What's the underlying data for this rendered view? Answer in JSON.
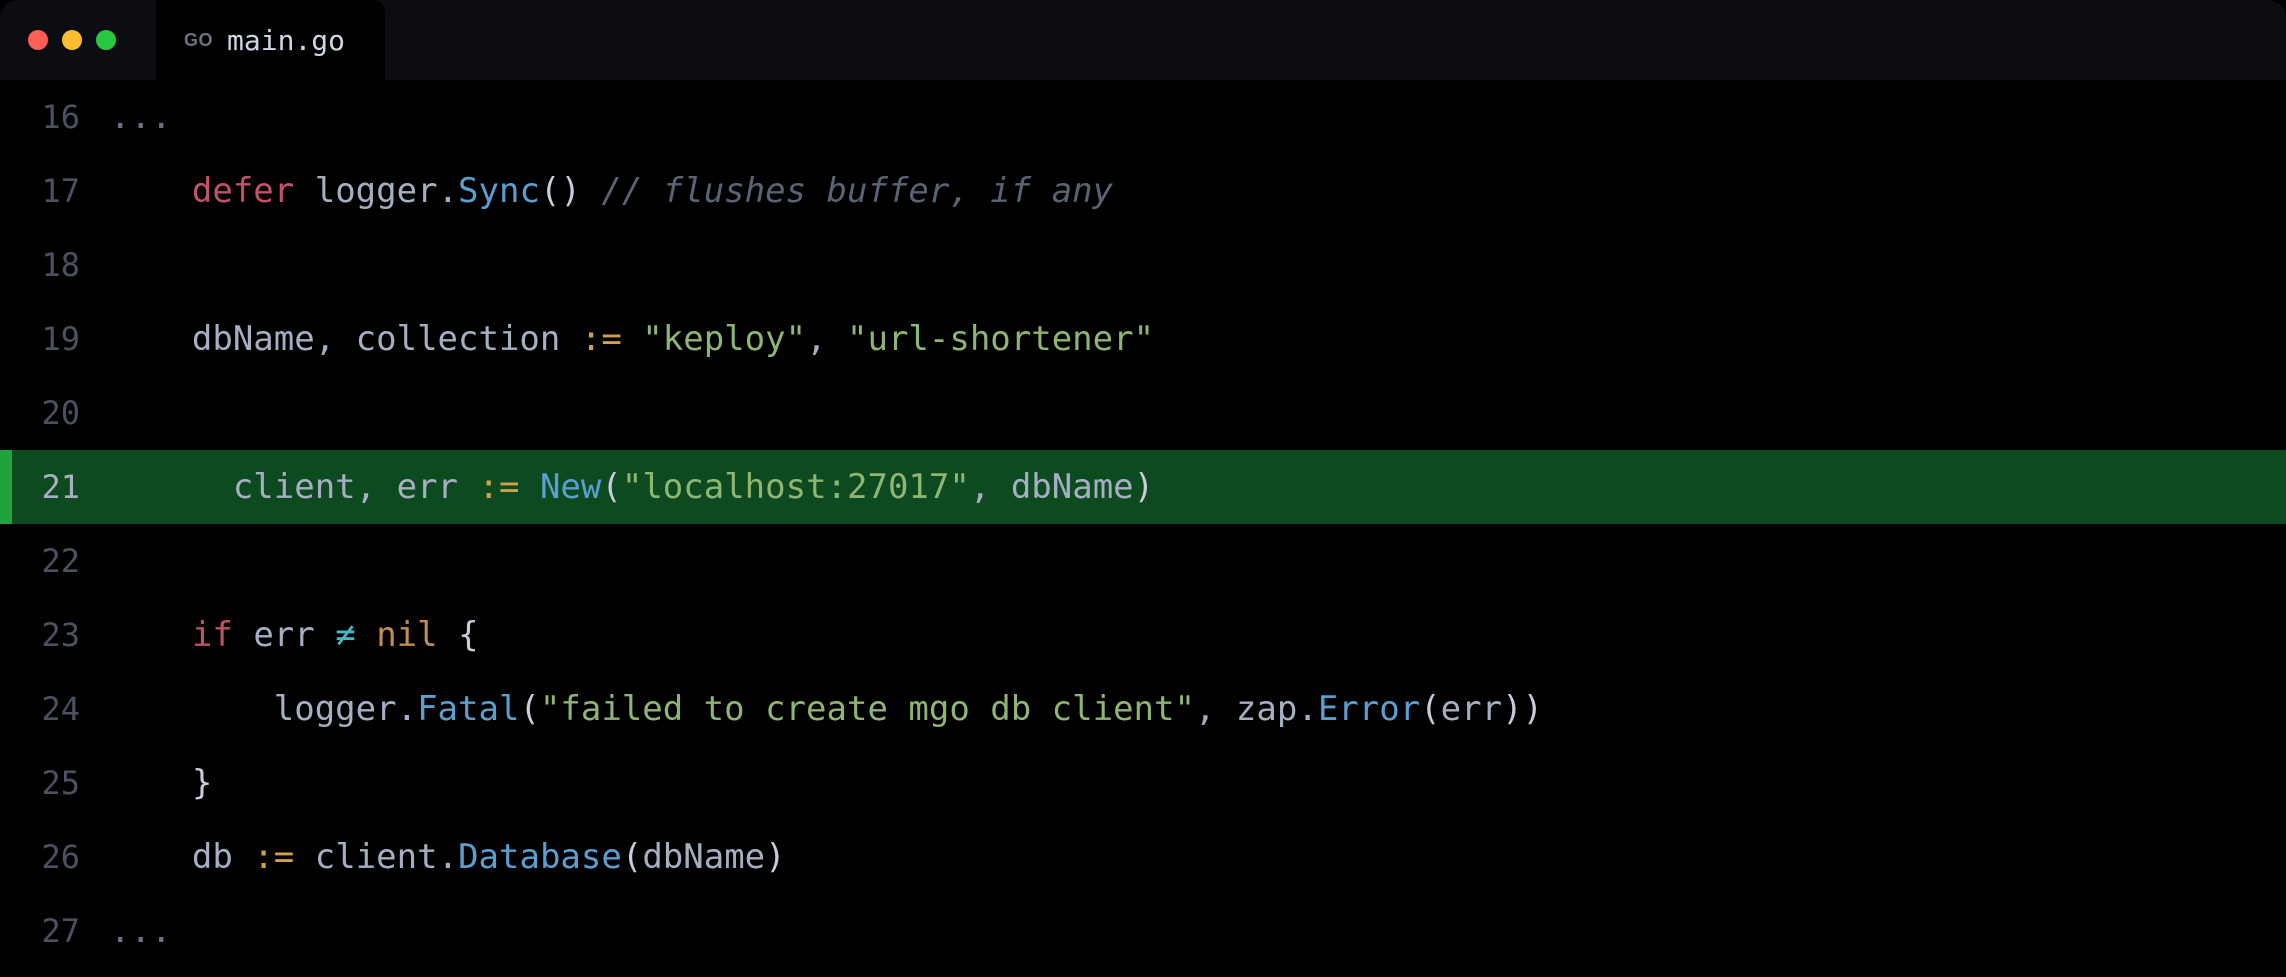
{
  "tab": {
    "language_badge": "GO",
    "title": "main.go"
  },
  "editor": {
    "lines": [
      {
        "num": "16",
        "fold": "..."
      },
      {
        "num": "17",
        "indent": "    ",
        "kw": "defer",
        "sp1": " ",
        "i1": "logger",
        "dot1": ".",
        "c1": "Sync",
        "p1": "()",
        "sp2": " ",
        "comment": "// flushes buffer, if any"
      },
      {
        "num": "18"
      },
      {
        "num": "19",
        "indent": "    ",
        "i1": "dbName",
        "comma1": ", ",
        "i2": "collection",
        "sp1": " ",
        "op": ":=",
        "sp2": " ",
        "s1": "\"keploy\"",
        "comma2": ", ",
        "s2": "\"url-shortener\""
      },
      {
        "num": "20"
      },
      {
        "num": "21",
        "hl": true,
        "indent": "      ",
        "i1": "client",
        "comma1": ", ",
        "i2": "err",
        "sp1": " ",
        "op": ":=",
        "sp2": " ",
        "c1": "New",
        "p1": "(",
        "s1": "\"localhost:27017\"",
        "comma2": ", ",
        "i3": "dbName",
        "p2": ")"
      },
      {
        "num": "22"
      },
      {
        "num": "23",
        "indent": "    ",
        "kw": "if",
        "sp1": " ",
        "i1": "err",
        "sp2": " ",
        "ne": "≠",
        "sp3": " ",
        "nil": "nil",
        "sp4": " ",
        "brace": "{"
      },
      {
        "num": "24",
        "indent": "        ",
        "i1": "logger",
        "dot1": ".",
        "c1": "Fatal",
        "p1": "(",
        "s1": "\"failed to create mgo db client\"",
        "comma1": ", ",
        "i2": "zap",
        "dot2": ".",
        "c2": "Error",
        "p2": "(",
        "i3": "err",
        "p3": "))"
      },
      {
        "num": "25",
        "indent": "    ",
        "brace": "}"
      },
      {
        "num": "26",
        "indent": "    ",
        "i1": "db",
        "sp1": " ",
        "op": ":=",
        "sp2": " ",
        "i2": "client",
        "dot1": ".",
        "c1": "Database",
        "p1": "(",
        "i3": "dbName",
        "p2": ")"
      },
      {
        "num": "27",
        "fold": "..."
      }
    ]
  }
}
